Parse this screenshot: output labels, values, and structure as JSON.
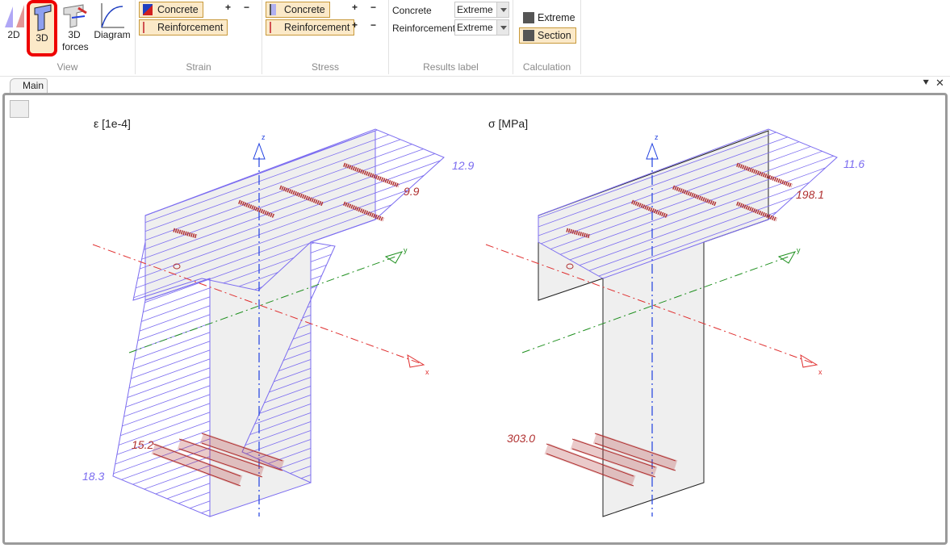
{
  "ribbon": {
    "view": {
      "label": "View",
      "buttons": [
        {
          "label": "2D",
          "icon": "2d-diagram-icon"
        },
        {
          "label": "3D",
          "icon": "3d-section-icon",
          "selected": true
        },
        {
          "label": "3D forces",
          "icon": "3d-forces-icon"
        },
        {
          "label": "Diagram",
          "icon": "stress-strain-diagram-icon"
        }
      ]
    },
    "strain": {
      "label": "Strain",
      "concrete": "Concrete",
      "reinforcement": "Reinforcement",
      "plus": "+",
      "minus": "−"
    },
    "stress": {
      "label": "Stress",
      "concrete": "Concrete",
      "reinforcement": "Reinforcement",
      "plus": "+",
      "minus": "−"
    },
    "results_label": {
      "label": "Results label",
      "concrete_label": "Concrete",
      "concrete_value": "Extreme",
      "reinforcement_label": "Reinforcement",
      "reinforcement_value": "Extreme"
    },
    "calculation": {
      "label": "Calculation",
      "extreme": "Extreme",
      "section": "Section"
    }
  },
  "tabs": [
    {
      "label": "Main",
      "active": true
    }
  ],
  "views": {
    "strain": {
      "title": "ε [1e-4]",
      "labels": [
        "12.9",
        "9.9",
        "15.2",
        "18.3"
      ],
      "axes": {
        "x": "x",
        "y": "y",
        "z": "z"
      }
    },
    "stress": {
      "title": "σ [MPa]",
      "labels": [
        "11.6",
        "198.1",
        "303.0"
      ],
      "axes": {
        "x": "x",
        "y": "y",
        "z": "z"
      }
    }
  },
  "colors": {
    "diagram": "#7b6cf0",
    "rebar": "#b03030",
    "x_axis": "#e03030",
    "y_axis": "#209020",
    "z_axis": "#2040e0",
    "highlight": "#fbe9c8"
  }
}
